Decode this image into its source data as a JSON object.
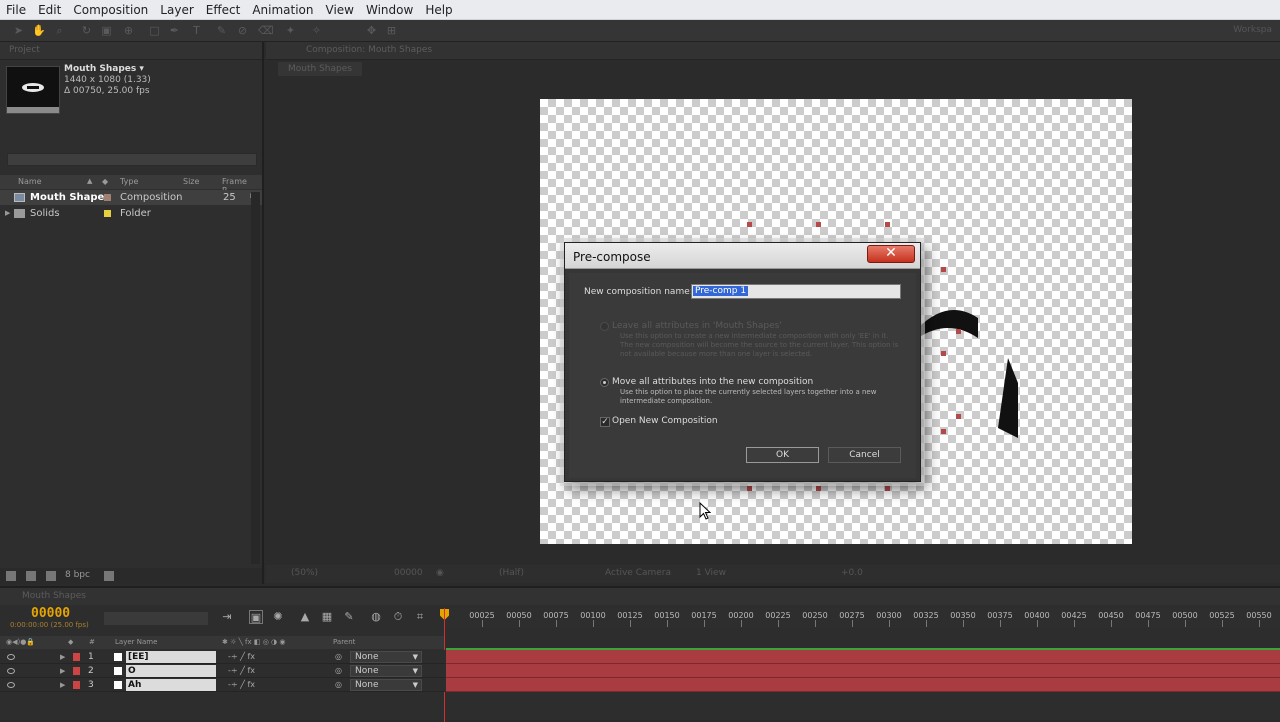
{
  "menu": [
    "File",
    "Edit",
    "Composition",
    "Layer",
    "Effect",
    "Animation",
    "View",
    "Window",
    "Help"
  ],
  "toolbar": {
    "workspace": "Workspa"
  },
  "project": {
    "tab": "Project",
    "comp_name": "Mouth Shapes ▾",
    "comp_size": "1440 x 1080 (1.33)",
    "comp_duration": "Δ 00750, 25.00 fps",
    "columns": {
      "name": "Name",
      "type": "Type",
      "size": "Size",
      "frame_rate": "Frame R..."
    },
    "items": [
      {
        "name": "Mouth Shapes",
        "type": "Composition",
        "frame_rate": "25",
        "label_color": "#a08070"
      },
      {
        "name": "Solids",
        "type": "Folder",
        "frame_rate": "",
        "label_color": "#e6d040"
      }
    ],
    "bpc": "8 bpc"
  },
  "viewer": {
    "tab": "Composition: Mouth Shapes",
    "breadcrumb": "Mouth Shapes",
    "zoom": "(50%)",
    "timecode": "00000",
    "resolution": "(Half)",
    "camera": "Active Camera",
    "views": "1 View",
    "exposure": "+0.0"
  },
  "dialog": {
    "title": "Pre-compose",
    "close": "✕",
    "name_label": "New composition name:",
    "name_value": "Pre-comp 1",
    "option1": {
      "label": "Leave all attributes in 'Mouth Shapes'",
      "desc": "Use this option to create a new intermediate composition with only 'EE' in it. The new composition will become the source to the current layer. This option is not available because more than one layer is selected.",
      "enabled": false
    },
    "option2": {
      "label": "Move all attributes into the new composition",
      "desc": "Use this option to place the currently selected layers together into a new intermediate composition.",
      "enabled": true
    },
    "open_new": {
      "label": "Open New Composition",
      "checked": true
    },
    "ok": "OK",
    "cancel": "Cancel"
  },
  "timeline": {
    "tab": "Mouth Shapes",
    "timecode": "00000",
    "timecode_sub": "0:00:00:00 (25.00 fps)",
    "header": {
      "layer_name": "Layer Name",
      "parent": "Parent",
      "num": "#"
    },
    "ruler": [
      "00025",
      "00050",
      "00075",
      "00100",
      "00125",
      "00150",
      "00175",
      "00200",
      "00225",
      "00250",
      "00275",
      "00300",
      "00325",
      "00350",
      "00375",
      "00400",
      "00425",
      "00450",
      "00475",
      "00500",
      "00525",
      "00550"
    ],
    "layers": [
      {
        "num": "1",
        "name": "[EE]",
        "parent": "None"
      },
      {
        "num": "2",
        "name": "O",
        "parent": "None"
      },
      {
        "num": "3",
        "name": "Ah",
        "parent": "None"
      }
    ]
  },
  "colors": {
    "accent": "#e6a400",
    "layer_bar": "#a83c40",
    "close_red": "#c5321e",
    "selection": "#3367d6"
  }
}
